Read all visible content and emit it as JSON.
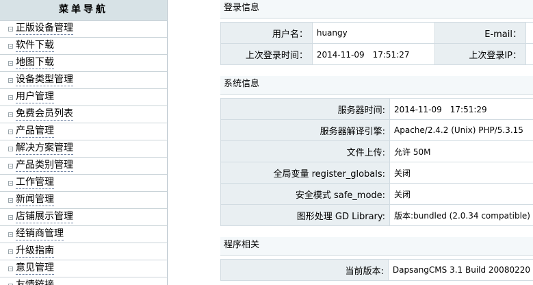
{
  "sidebar": {
    "title": "菜单导航",
    "items": [
      {
        "label": "正版设备管理"
      },
      {
        "label": "软件下载"
      },
      {
        "label": "地图下载"
      },
      {
        "label": "设备类型管理"
      },
      {
        "label": "用户管理"
      },
      {
        "label": "免费会员列表"
      },
      {
        "label": "产品管理"
      },
      {
        "label": "解决方案管理"
      },
      {
        "label": "产品类别管理"
      },
      {
        "label": "工作管理"
      },
      {
        "label": "新闻管理"
      },
      {
        "label": "店铺展示管理"
      },
      {
        "label": "经销商管理"
      },
      {
        "label": "升级指南"
      },
      {
        "label": "意见管理"
      },
      {
        "label": "友情链接"
      }
    ]
  },
  "login_info": {
    "title": "登录信息",
    "username_label": "用户名：",
    "username_value": "huangy",
    "email_label": "E-mail：",
    "last_login_time_label": "上次登录时间：",
    "last_login_time_value": "2014-11-09　17:51:27",
    "last_login_ip_label": "上次登录IP："
  },
  "system_info": {
    "title": "系统信息",
    "rows": [
      {
        "label": "服务器时间:",
        "value": "2014-11-09　17:51:29"
      },
      {
        "label": "服务器解译引擎:",
        "value": "Apache/2.4.2 (Unix) PHP/5.3.15"
      },
      {
        "label": "文件上传:",
        "value": "允许 50M"
      },
      {
        "label": "全局变量 register_globals:",
        "value": "关闭"
      },
      {
        "label": "安全模式 safe_mode:",
        "value": "关闭"
      },
      {
        "label": "图形处理 GD Library:",
        "value": "版本:bundled (2.0.34 compatible)"
      }
    ]
  },
  "program_info": {
    "title": "程序相关",
    "rows": [
      {
        "label": "当前版本:",
        "value": "DapsangCMS 3.1 Build 20080220"
      }
    ]
  }
}
